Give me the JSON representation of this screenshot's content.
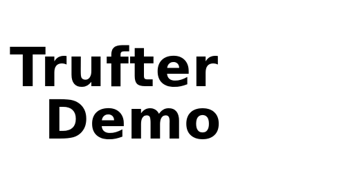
{
  "title": {
    "line_1": "Trufter",
    "line_2": "Demo"
  },
  "colors": {
    "background": "#ffffff",
    "text": "#000000"
  }
}
